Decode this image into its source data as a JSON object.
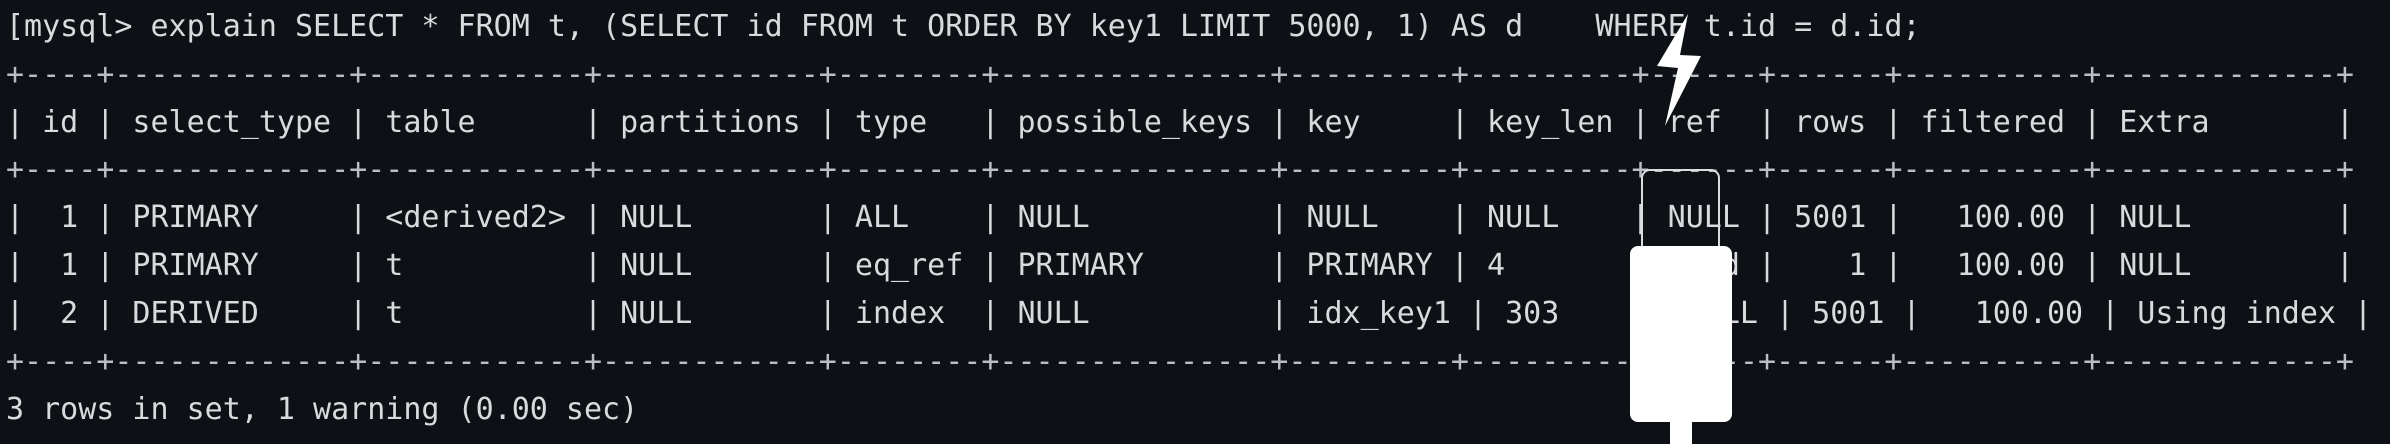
{
  "terminal": {
    "command_line": "[mysql> explain SELECT * FROM t, (SELECT id FROM t ORDER BY key1 LIMIT 5000, 1) AS d    WHERE t.id = d.id;",
    "border_top": "+----+-------------+------------+------------+--------+---------------+---------+---------+------+------+----------+-------------+",
    "header_row": "| id | select_type | table      | partitions | type   | possible_keys | key     | key_len | ref  | rows | filtered | Extra       |",
    "border_mid": "+----+-------------+------------+------------+--------+---------------+---------+---------+------+------+----------+-------------+",
    "rows": [
      "|  1 | PRIMARY     | <derived2> | NULL       | ALL    | NULL          | NULL    | NULL    | NULL | 5001 |   100.00 | NULL        |",
      "|  1 | PRIMARY     | t          | NULL       | eq_ref | PRIMARY       | PRIMARY | 4       | d.id |    1 |   100.00 | NULL        |",
      "|  2 | DERIVED     | t          | NULL       | index  | NULL          | idx_key1 | 303     | NULL | 5001 |   100.00 | Using index |"
    ],
    "border_bottom": "+----+-------------+------------+------------+--------+---------------+---------+---------+------+------+----------+-------------+",
    "footer": "3 rows in set, 1 warning (0.00 sec)"
  },
  "overlay": {
    "icon": "plug-lightning-icon",
    "colors": {
      "plug": "#ffffff",
      "background": "#0d1014",
      "text": "#d8dade"
    }
  }
}
